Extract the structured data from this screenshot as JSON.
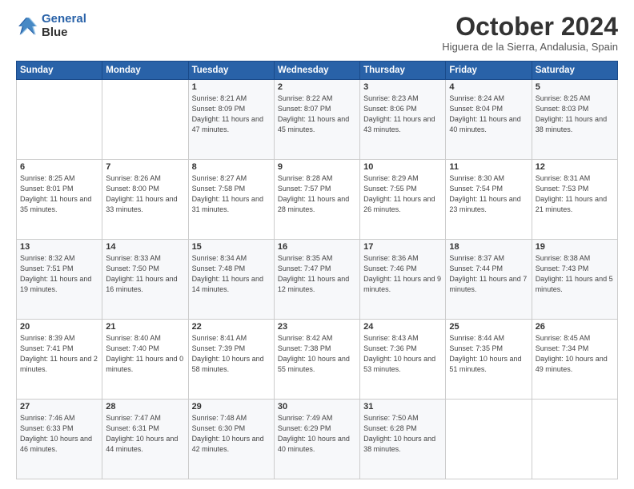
{
  "header": {
    "logo_line1": "General",
    "logo_line2": "Blue",
    "month": "October 2024",
    "location": "Higuera de la Sierra, Andalusia, Spain"
  },
  "weekdays": [
    "Sunday",
    "Monday",
    "Tuesday",
    "Wednesday",
    "Thursday",
    "Friday",
    "Saturday"
  ],
  "weeks": [
    [
      {
        "day": "",
        "info": ""
      },
      {
        "day": "",
        "info": ""
      },
      {
        "day": "1",
        "info": "Sunrise: 8:21 AM\nSunset: 8:09 PM\nDaylight: 11 hours and 47 minutes."
      },
      {
        "day": "2",
        "info": "Sunrise: 8:22 AM\nSunset: 8:07 PM\nDaylight: 11 hours and 45 minutes."
      },
      {
        "day": "3",
        "info": "Sunrise: 8:23 AM\nSunset: 8:06 PM\nDaylight: 11 hours and 43 minutes."
      },
      {
        "day": "4",
        "info": "Sunrise: 8:24 AM\nSunset: 8:04 PM\nDaylight: 11 hours and 40 minutes."
      },
      {
        "day": "5",
        "info": "Sunrise: 8:25 AM\nSunset: 8:03 PM\nDaylight: 11 hours and 38 minutes."
      }
    ],
    [
      {
        "day": "6",
        "info": "Sunrise: 8:25 AM\nSunset: 8:01 PM\nDaylight: 11 hours and 35 minutes."
      },
      {
        "day": "7",
        "info": "Sunrise: 8:26 AM\nSunset: 8:00 PM\nDaylight: 11 hours and 33 minutes."
      },
      {
        "day": "8",
        "info": "Sunrise: 8:27 AM\nSunset: 7:58 PM\nDaylight: 11 hours and 31 minutes."
      },
      {
        "day": "9",
        "info": "Sunrise: 8:28 AM\nSunset: 7:57 PM\nDaylight: 11 hours and 28 minutes."
      },
      {
        "day": "10",
        "info": "Sunrise: 8:29 AM\nSunset: 7:55 PM\nDaylight: 11 hours and 26 minutes."
      },
      {
        "day": "11",
        "info": "Sunrise: 8:30 AM\nSunset: 7:54 PM\nDaylight: 11 hours and 23 minutes."
      },
      {
        "day": "12",
        "info": "Sunrise: 8:31 AM\nSunset: 7:53 PM\nDaylight: 11 hours and 21 minutes."
      }
    ],
    [
      {
        "day": "13",
        "info": "Sunrise: 8:32 AM\nSunset: 7:51 PM\nDaylight: 11 hours and 19 minutes."
      },
      {
        "day": "14",
        "info": "Sunrise: 8:33 AM\nSunset: 7:50 PM\nDaylight: 11 hours and 16 minutes."
      },
      {
        "day": "15",
        "info": "Sunrise: 8:34 AM\nSunset: 7:48 PM\nDaylight: 11 hours and 14 minutes."
      },
      {
        "day": "16",
        "info": "Sunrise: 8:35 AM\nSunset: 7:47 PM\nDaylight: 11 hours and 12 minutes."
      },
      {
        "day": "17",
        "info": "Sunrise: 8:36 AM\nSunset: 7:46 PM\nDaylight: 11 hours and 9 minutes."
      },
      {
        "day": "18",
        "info": "Sunrise: 8:37 AM\nSunset: 7:44 PM\nDaylight: 11 hours and 7 minutes."
      },
      {
        "day": "19",
        "info": "Sunrise: 8:38 AM\nSunset: 7:43 PM\nDaylight: 11 hours and 5 minutes."
      }
    ],
    [
      {
        "day": "20",
        "info": "Sunrise: 8:39 AM\nSunset: 7:41 PM\nDaylight: 11 hours and 2 minutes."
      },
      {
        "day": "21",
        "info": "Sunrise: 8:40 AM\nSunset: 7:40 PM\nDaylight: 11 hours and 0 minutes."
      },
      {
        "day": "22",
        "info": "Sunrise: 8:41 AM\nSunset: 7:39 PM\nDaylight: 10 hours and 58 minutes."
      },
      {
        "day": "23",
        "info": "Sunrise: 8:42 AM\nSunset: 7:38 PM\nDaylight: 10 hours and 55 minutes."
      },
      {
        "day": "24",
        "info": "Sunrise: 8:43 AM\nSunset: 7:36 PM\nDaylight: 10 hours and 53 minutes."
      },
      {
        "day": "25",
        "info": "Sunrise: 8:44 AM\nSunset: 7:35 PM\nDaylight: 10 hours and 51 minutes."
      },
      {
        "day": "26",
        "info": "Sunrise: 8:45 AM\nSunset: 7:34 PM\nDaylight: 10 hours and 49 minutes."
      }
    ],
    [
      {
        "day": "27",
        "info": "Sunrise: 7:46 AM\nSunset: 6:33 PM\nDaylight: 10 hours and 46 minutes."
      },
      {
        "day": "28",
        "info": "Sunrise: 7:47 AM\nSunset: 6:31 PM\nDaylight: 10 hours and 44 minutes."
      },
      {
        "day": "29",
        "info": "Sunrise: 7:48 AM\nSunset: 6:30 PM\nDaylight: 10 hours and 42 minutes."
      },
      {
        "day": "30",
        "info": "Sunrise: 7:49 AM\nSunset: 6:29 PM\nDaylight: 10 hours and 40 minutes."
      },
      {
        "day": "31",
        "info": "Sunrise: 7:50 AM\nSunset: 6:28 PM\nDaylight: 10 hours and 38 minutes."
      },
      {
        "day": "",
        "info": ""
      },
      {
        "day": "",
        "info": ""
      }
    ]
  ]
}
